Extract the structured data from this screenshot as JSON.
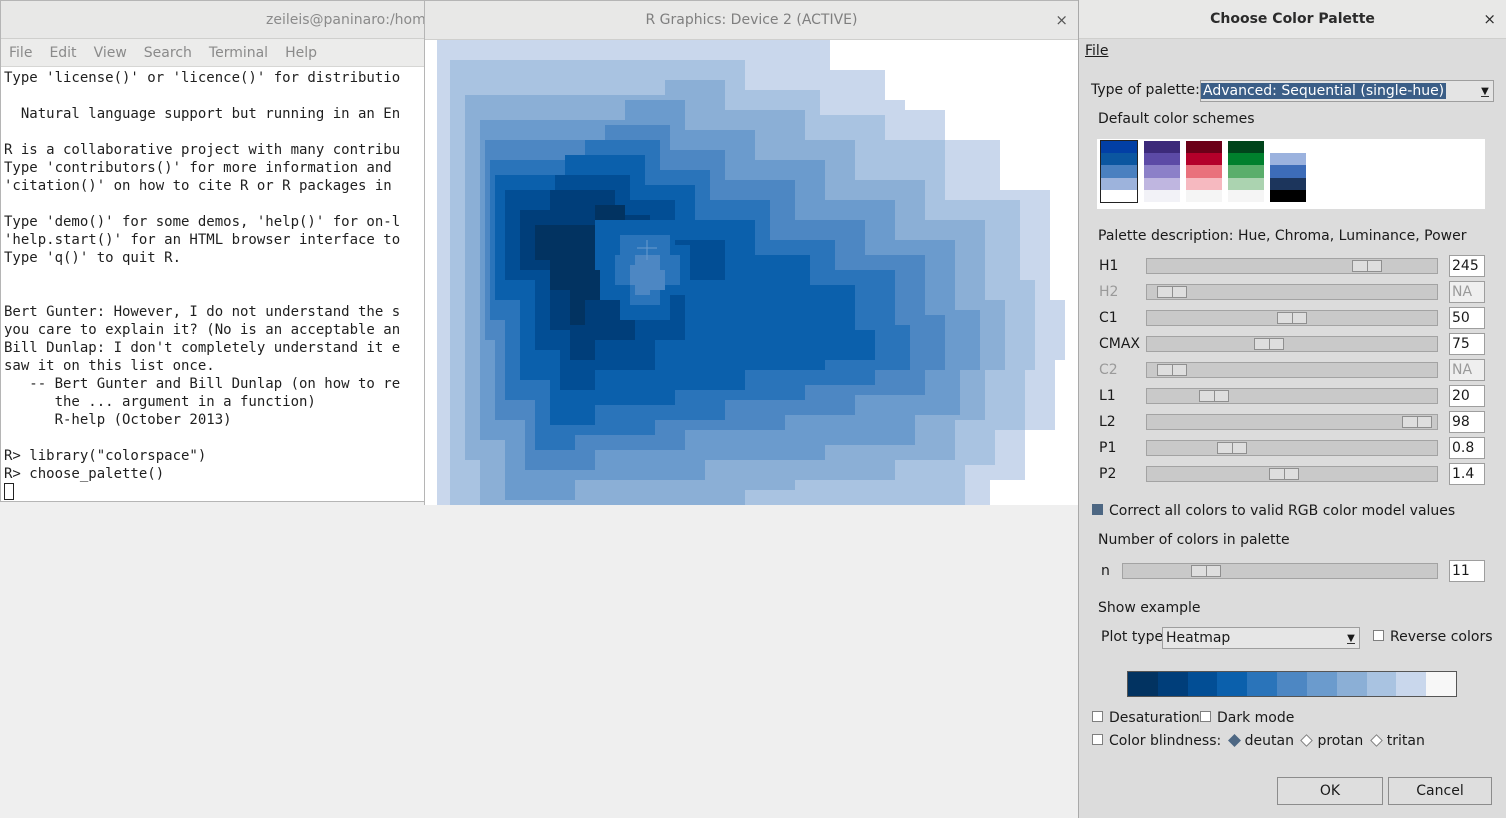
{
  "terminal": {
    "title": "zeileis@paninaro:/home",
    "menu": [
      "File",
      "Edit",
      "View",
      "Search",
      "Terminal",
      "Help"
    ],
    "lines": [
      "Type 'license()' or 'licence()' for distributio",
      "",
      "  Natural language support but running in an En",
      "",
      "R is a collaborative project with many contribu",
      "Type 'contributors()' for more information and",
      "'citation()' on how to cite R or R packages in",
      "",
      "Type 'demo()' for some demos, 'help()' for on-l",
      "'help.start()' for an HTML browser interface to",
      "Type 'q()' to quit R.",
      "",
      "",
      "Bert Gunter: However, I do not understand the s",
      "you care to explain it? (No is an acceptable an",
      "Bill Dunlap: I don't completely understand it e",
      "saw it on this list once.",
      "   -- Bert Gunter and Bill Dunlap (on how to re",
      "      the ... argument in a function)",
      "      R-help (October 2013)",
      "",
      "R> library(\"colorspace\")",
      "R> choose_palette()"
    ]
  },
  "graphics": {
    "title": "R Graphics: Device 2 (ACTIVE)",
    "close": "×"
  },
  "dialog": {
    "title": "Choose Color Palette",
    "close": "×",
    "file_menu": "File",
    "type_label": "Type of palette:",
    "type_value": "Advanced: Sequential (single-hue)",
    "default_schemes_label": "Default color schemes",
    "schemes": [
      [
        "#023FA5",
        "#0B56A0",
        "#4A80C0",
        "#9DB3DC",
        "#FFFFFF"
      ],
      [
        "#3C2A7A",
        "#5C4AA6",
        "#8C80C8",
        "#BFB6E0",
        "#F2F2F7"
      ],
      [
        "#6B0018",
        "#B4002A",
        "#E9717C",
        "#F6B9C0",
        "#F5F5F5"
      ],
      [
        "#00441B",
        "#00802D",
        "#5AAE6B",
        "#ABD3B0",
        "#F5F5F5"
      ],
      [
        "#FFFFFF",
        "#9BB2DE",
        "#3D6CB8",
        "#1C355C",
        "#000000"
      ]
    ],
    "palette_description_label": "Palette description: Hue, Chroma, Luminance, Power",
    "params": [
      {
        "name": "H1",
        "value": "245",
        "level": 0.79,
        "disabled": false
      },
      {
        "name": "H2",
        "value": "NA",
        "level": 0.04,
        "disabled": true
      },
      {
        "name": "C1",
        "value": "50",
        "level": 0.5,
        "disabled": false
      },
      {
        "name": "CMAX",
        "value": "75",
        "level": 0.41,
        "disabled": false
      },
      {
        "name": "C2",
        "value": "NA",
        "level": 0.04,
        "disabled": true
      },
      {
        "name": "L1",
        "value": "20",
        "level": 0.2,
        "disabled": false
      },
      {
        "name": "L2",
        "value": "98",
        "level": 0.98,
        "disabled": false
      },
      {
        "name": "P1",
        "value": "0.8",
        "level": 0.27,
        "disabled": false
      },
      {
        "name": "P2",
        "value": "1.4",
        "level": 0.47,
        "disabled": false
      }
    ],
    "correct_label": "Correct all colors to valid RGB color model values",
    "ncolors_label": "Number of colors in palette",
    "n_label": "n",
    "n_value": "11",
    "n_level": 0.24,
    "show_example_label": "Show example",
    "plot_type_label": "Plot type",
    "plot_type_value": "Heatmap",
    "reverse_label": "Reverse colors",
    "palette_colors": [
      "#023361",
      "#003E7A",
      "#024E95",
      "#0B60AC",
      "#2A74BA",
      "#4D87C3",
      "#6B9BCD",
      "#8BAFD6",
      "#A9C3E1",
      "#C9D7EC",
      "#F7F7F7"
    ],
    "desaturation_label": "Desaturation",
    "dark_mode_label": "Dark mode",
    "color_blindness_label": "Color blindness:",
    "cb_options": [
      "deutan",
      "protan",
      "tritan"
    ],
    "ok_label": "OK",
    "cancel_label": "Cancel"
  }
}
